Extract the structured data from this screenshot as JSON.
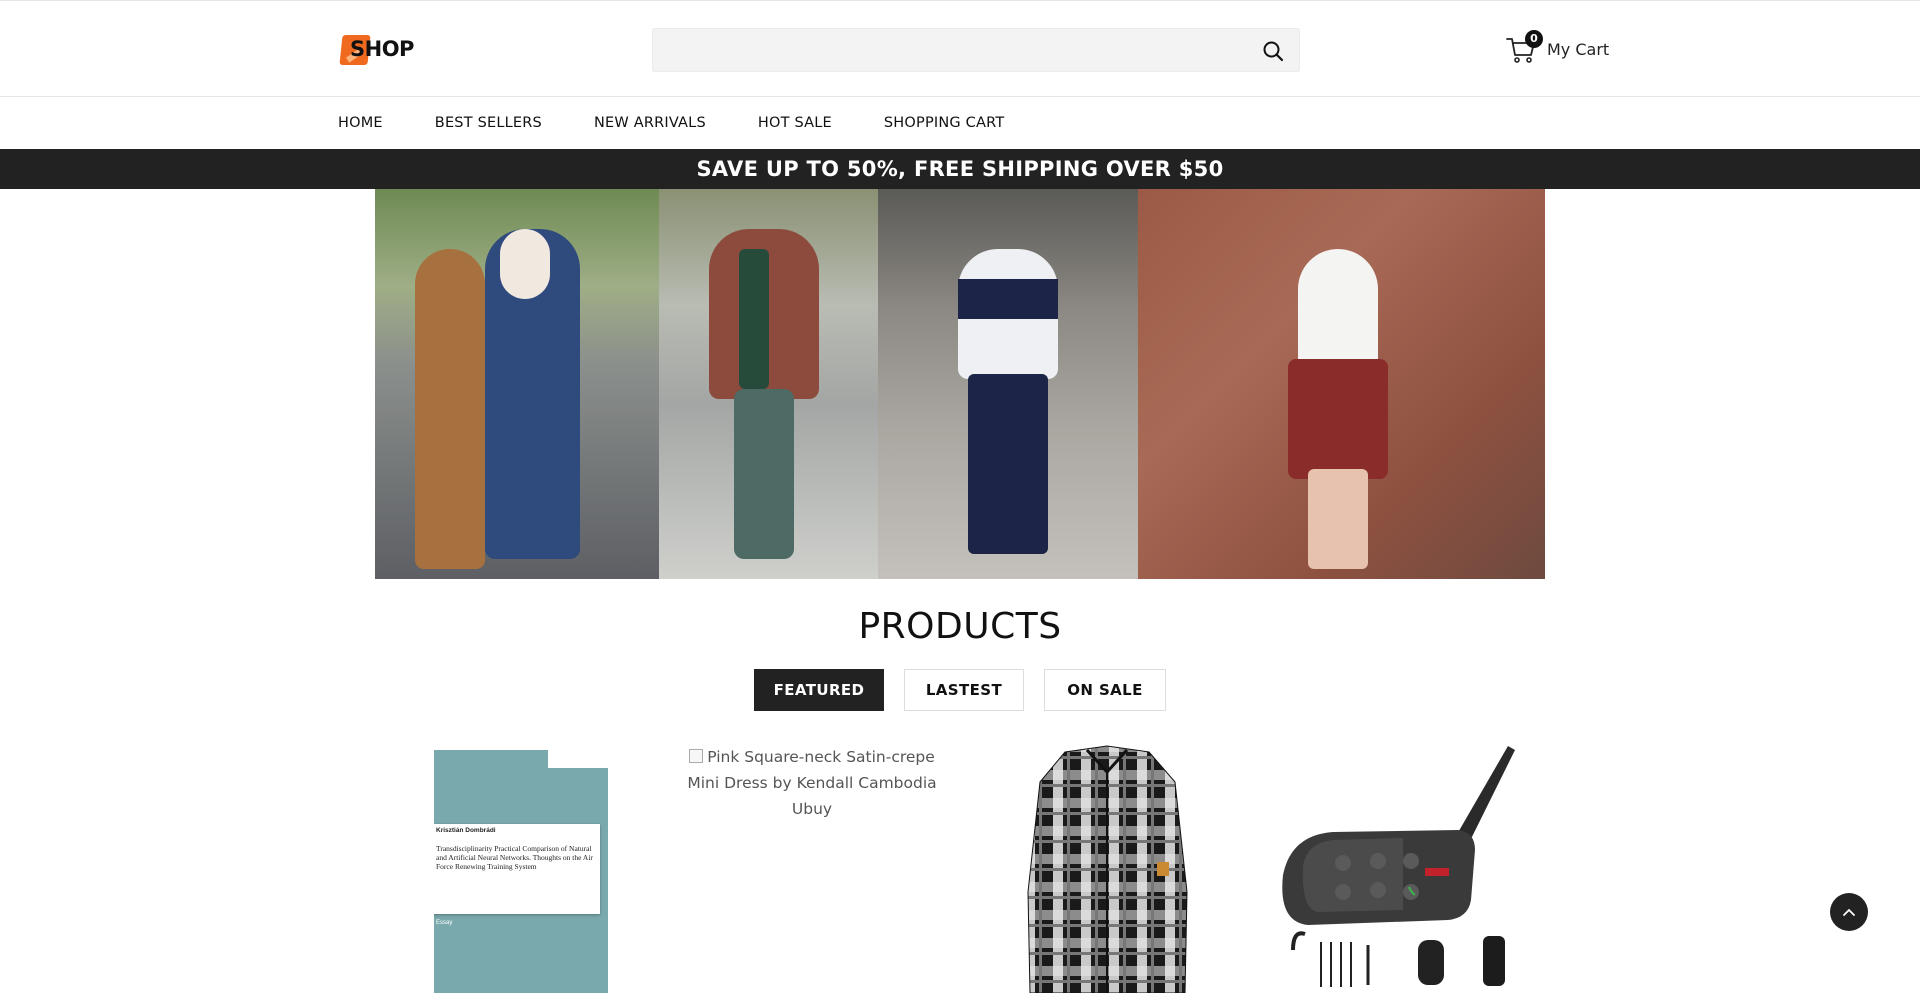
{
  "header": {
    "logo_text": "SHOP",
    "search_placeholder": "",
    "cart": {
      "count": "0",
      "label": "My Cart"
    }
  },
  "nav": {
    "items": [
      {
        "label": "HOME"
      },
      {
        "label": "BEST SELLERS"
      },
      {
        "label": "NEW ARRIVALS"
      },
      {
        "label": "HOT SALE"
      },
      {
        "label": "SHOPPING CART"
      }
    ]
  },
  "promo": {
    "text": "SAVE UP TO 50%, FREE SHIPPING OVER $50"
  },
  "products": {
    "title": "PRODUCTS",
    "tabs": [
      {
        "label": "FEATURED",
        "active": true
      },
      {
        "label": "LASTEST",
        "active": false
      },
      {
        "label": "ON SALE",
        "active": false
      }
    ],
    "items": [
      {
        "book_author": "Krisztián Dombrádi",
        "book_title": "Transdisciplinarity Practical Comparison of Natural and Artificial Neural Networks. Thoughts on the Air Force Renewing Training System",
        "book_type": "Essay"
      },
      {
        "alt_text": "Pink Square-neck Satin-crepe Mini Dress by Kendall Cambodia Ubuy"
      },
      {
        "alt_text": ""
      },
      {
        "alt_text": ""
      }
    ]
  },
  "colors": {
    "accent": "#ef6a1f",
    "dark": "#222222",
    "book_cover": "#7aa9ad"
  }
}
